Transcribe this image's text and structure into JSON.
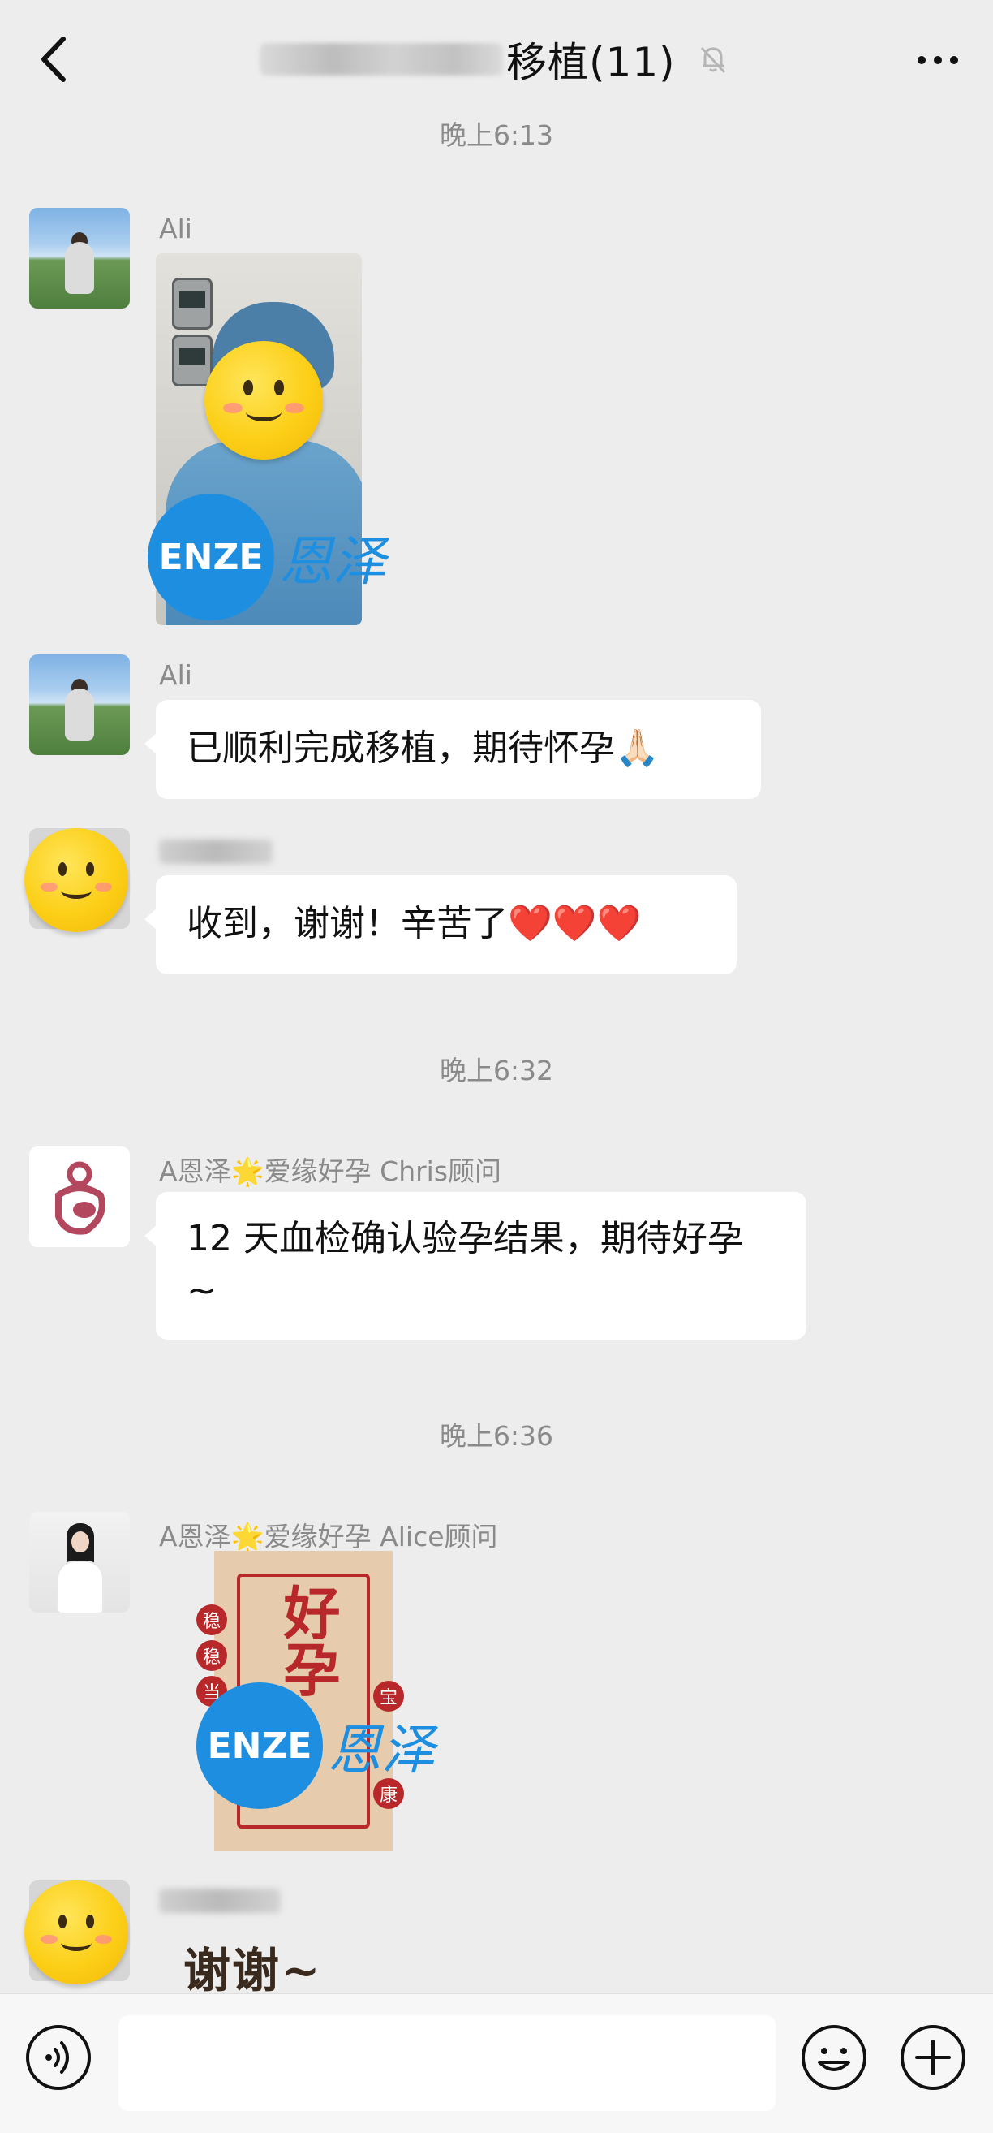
{
  "header": {
    "title": "移植(11)",
    "back_icon": "chevron-left-icon",
    "mute_icon": "bell-muted-icon",
    "more_icon": "more-horizontal-icon"
  },
  "times": [
    "晚上6:13",
    "晚上6:32",
    "晚上6:36"
  ],
  "messages": [
    {
      "sender": "Ali",
      "type": "image",
      "watermark": {
        "logo": "ENZE",
        "text": "恩泽"
      }
    },
    {
      "sender": "Ali",
      "type": "text",
      "text": "已顺利完成移植，期待怀孕🙏🏻"
    },
    {
      "sender": "",
      "type": "text",
      "text": "收到，谢谢！辛苦了❤️❤️❤️"
    },
    {
      "sender": "A恩泽🌟爱缘好孕 Chris顾问",
      "type": "text",
      "text": "12 天血检确认验孕结果，期待好孕 ~"
    },
    {
      "sender": "A恩泽🌟爱缘好孕 Alice顾问",
      "type": "sticker",
      "sticker_text": "好孕",
      "watermark": {
        "logo": "ENZE",
        "text": "恩泽"
      }
    },
    {
      "sender": "",
      "type": "sticker",
      "sticker_text": "谢谢~"
    }
  ],
  "sticker_seals_left": [
    "稳",
    "稳",
    "当"
  ],
  "sticker_seals_right": [
    "宝",
    "康"
  ],
  "input_bar": {
    "voice_icon": "voice-icon",
    "emoji_icon": "emoji-icon",
    "plus_icon": "plus-circle-icon",
    "input_value": ""
  },
  "colors": {
    "background": "#ededed",
    "bubble": "#ffffff",
    "accent_enze": "#1e8fe0",
    "sticker_red": "#b8282a"
  }
}
